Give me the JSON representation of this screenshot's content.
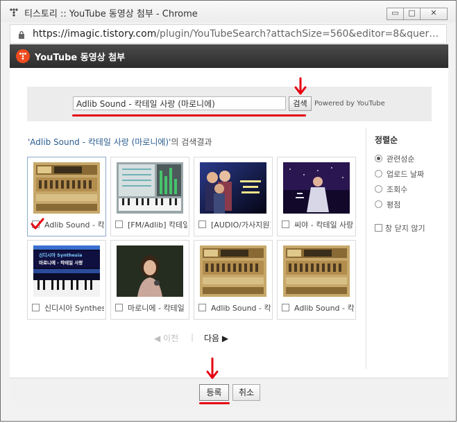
{
  "window": {
    "title": "티스토리 :: YouTube 동영상 첨부 - Chrome",
    "url_host": "https://imagic.tistory.com",
    "url_path": "/plugin/YouTubeSearch?attachSize=560&editor=8&query=Adli…",
    "min_glyph": "▭",
    "max_glyph": "□",
    "close_glyph": "✕"
  },
  "header": {
    "title": "YouTube 동영상 첨부"
  },
  "search": {
    "query": "Adlib Sound - 칵테일 사랑 (마로니에)",
    "button_label": "검색",
    "powered_by": "Powered by YouTube"
  },
  "results": {
    "heading_query": "'Adlib Sound - 칵테일 사랑 (마로니에)'",
    "heading_suffix": "의 검색결과",
    "items": [
      {
        "title": "Adlib Sound - 칵테일",
        "checked": true
      },
      {
        "title": "[FM/Adlib] 칵테일 사랑",
        "checked": false
      },
      {
        "title": "[AUDIO/가사지원]",
        "checked": false
      },
      {
        "title": "씨야 - 칵테일 사랑",
        "checked": false
      },
      {
        "title": "신디시아 Synthesia",
        "checked": false
      },
      {
        "title": "마로니에 - 칵테일 사랑",
        "checked": false
      },
      {
        "title": "Adlib Sound - 칵테일",
        "checked": false
      },
      {
        "title": "Adlib Sound - 칵테일",
        "checked": false
      }
    ],
    "thumb_texts": {
      "synth_line1": "신디시아 Synthesia",
      "synth_line2": "마로니에 - 칵테일 사랑"
    }
  },
  "sort": {
    "title": "정렬순",
    "options": [
      {
        "label": "관련성순",
        "selected": true
      },
      {
        "label": "업로드 날짜",
        "selected": false
      },
      {
        "label": "조회수",
        "selected": false
      },
      {
        "label": "평점",
        "selected": false
      }
    ],
    "window_option": "창 닫지 않기"
  },
  "pager": {
    "prev": "◀ 이전",
    "separator": "|",
    "next": "다음 ▶"
  },
  "footer": {
    "submit": "등록",
    "cancel": "취소"
  },
  "colors": {
    "annotation_red": "#e60012",
    "link_blue": "#2a5c8f"
  }
}
